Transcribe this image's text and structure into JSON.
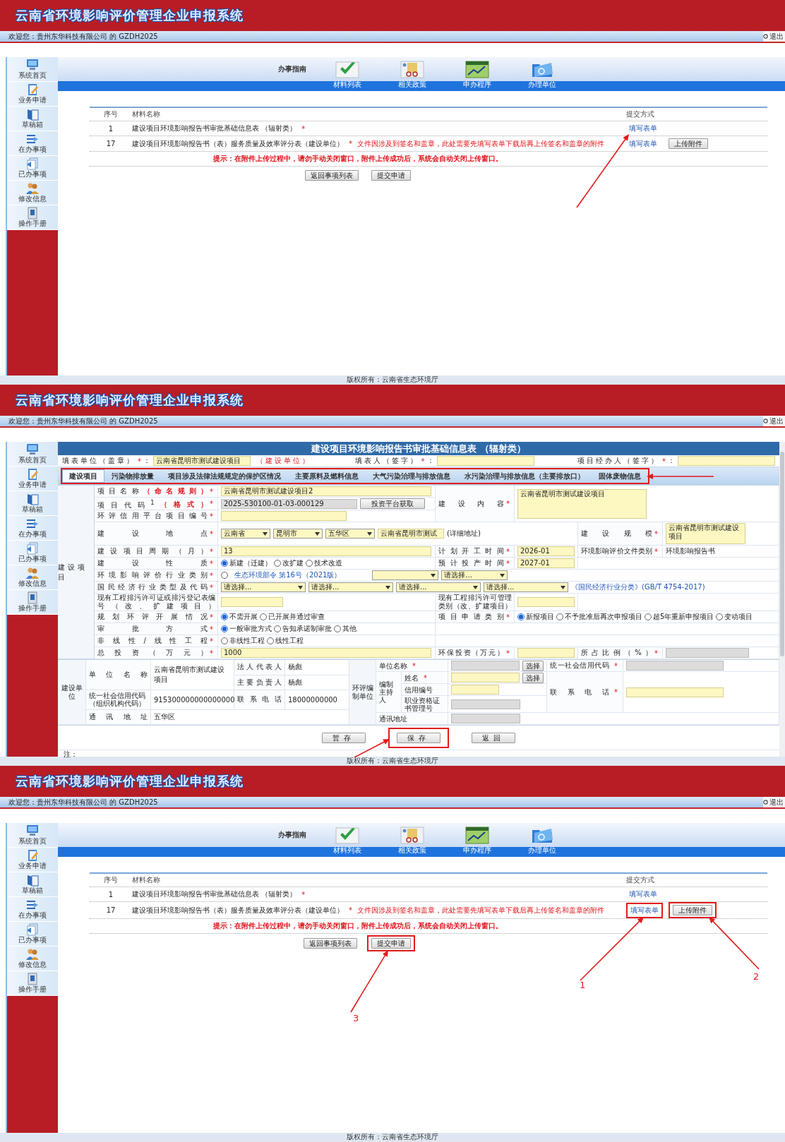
{
  "screens": [
    {
      "kind": "list",
      "title": "云南省环境影响评价管理企业申报系统",
      "welcome": "欢迎您：贵州东华科技有限公司 的 GZDH2025",
      "logout": "退出",
      "sidebar": [
        {
          "label": "系统首页"
        },
        {
          "label": "业务申请"
        },
        {
          "label": "草稿箱"
        },
        {
          "label": "在办事项"
        },
        {
          "label": "已办事项"
        },
        {
          "label": "修改信息"
        },
        {
          "label": "操作手册"
        }
      ],
      "guide": {
        "label": "办事指南",
        "items": [
          {
            "label": "材料列表"
          },
          {
            "label": "相关政策"
          },
          {
            "label": "申办程序"
          },
          {
            "label": "办理单位"
          }
        ]
      },
      "table": {
        "columns": [
          "序号",
          "材料名称",
          "提交方式"
        ],
        "rows": [
          {
            "no": "1",
            "name": "建设项目环境影响报告书审批基础信息表 （辐射类）",
            "required": true,
            "mark": "*",
            "actions": [
              {
                "kind": "link",
                "label": "填写表单",
                "highlighted": false,
                "pointer": true
              }
            ]
          },
          {
            "no": "17",
            "name": "建设项目环境影响报告书（表）服务质量及效率评分表（建设单位）",
            "required": true,
            "mark": "*",
            "note": "文件因涉及到签名和盖章，此处需要先填写表单下载后再上传签名和盖章的附件",
            "actions": [
              {
                "kind": "link",
                "label": "填写表单",
                "highlighted": false,
                "pointer": false
              },
              {
                "kind": "button",
                "label": "上传附件",
                "highlighted": false,
                "pointer": false
              }
            ]
          }
        ]
      },
      "hint": "提示：在附件上传过程中，请勿手动关闭窗口，附件上传成功后，系统会自动关闭上传窗口。",
      "buttons": [
        {
          "label": "返回事项列表",
          "highlighted": false,
          "pointer": false
        },
        {
          "label": "提交申请",
          "highlighted": false,
          "pointer": false
        }
      ],
      "footer": "版权所有：云南省生态环境厅"
    },
    {
      "kind": "form",
      "title": "云南省环境影响评价管理企业申报系统",
      "welcome": "欢迎您：贵州东华科技有限公司 的 GZDH2025",
      "logout": "退出",
      "sidebar": [
        {
          "label": "系统首页"
        },
        {
          "label": "业务申请"
        },
        {
          "label": "草稿箱"
        },
        {
          "label": "在办事项"
        },
        {
          "label": "已办事项"
        },
        {
          "label": "修改信息"
        },
        {
          "label": "操作手册"
        }
      ],
      "form": {
        "title": "建设项目环境影响报告书审批基础信息表 （辐射类）",
        "signers": [
          {
            "label": "填表单位（盖章）",
            "required": true,
            "mark": "*",
            "colon": "：",
            "value": "云南省昆明市测试建设项目",
            "suffix": "（建设单位）"
          },
          {
            "label": "填表人（签字）",
            "required": true,
            "mark": "*",
            "colon": "："
          },
          {
            "label": "项目经办人（签字）",
            "required": true,
            "mark": "*",
            "colon": "："
          }
        ],
        "tabs": [
          {
            "label": "建设项目",
            "selected": true
          },
          {
            "label": "污染物排放量",
            "selected": false
          },
          {
            "label": "项目涉及法律法规规定的保护区情况",
            "selected": false
          },
          {
            "label": "主要原料及燃料信息",
            "selected": false
          },
          {
            "label": "大气污染治理与排放信息",
            "selected": false
          },
          {
            "label": "水污染治理与排放信息（主要排放口）",
            "selected": false
          },
          {
            "label": "固体废物信息",
            "selected": false
          }
        ],
        "tabs_highlighted": true,
        "tabs_pointer": true,
        "project": {
          "section": "建设项目",
          "rows": [
            {
              "groups": [
                {
                  "label": "项目名称",
                  "rule": "（命名规则）",
                  "required": true,
                  "mark": "*",
                  "fields": [
                    {
                      "kind": "input",
                      "value": "云南省昆明市测试建设项目2"
                    }
                  ]
                },
                {
                  "label": "建设内容",
                  "required": true,
                  "mark": "*",
                  "fields": [
                    {
                      "kind": "textarea",
                      "value": "云南省昆明市测试建设项目"
                    }
                  ]
                }
              ]
            },
            {
              "groups": [
                {
                  "label": "项目代码$^{1}$",
                  "rule": "（格式）",
                  "required": true,
                  "mark": "*",
                  "fields": [
                    {
                      "kind": "input",
                      "value": "2025-530100-01-03-000129",
                      "readonly": true
                    },
                    {
                      "kind": "button",
                      "label": "投资平台获取"
                    }
                  ]
                }
              ]
            },
            {
              "groups": [
                {
                  "label": "环评信用平台项目编号",
                  "required": true,
                  "mark": "*",
                  "fields": [
                    {
                      "kind": "input"
                    }
                  ]
                }
              ]
            },
            {
              "groups": [
                {
                  "label": "建设地点",
                  "required": true,
                  "mark": "*",
                  "fields": [
                    {
                      "kind": "select",
                      "value": "云南省"
                    },
                    {
                      "kind": "select",
                      "value": "昆明市"
                    },
                    {
                      "kind": "select",
                      "value": "五华区"
                    },
                    {
                      "kind": "input",
                      "value": "云南省昆明市测试"
                    },
                    {
                      "kind": "text",
                      "text": "(详细地址)"
                    }
                  ]
                },
                {
                  "label": "建设规模",
                  "required": true,
                  "mark": "*",
                  "fields": [
                    {
                      "kind": "textarea",
                      "value": "云南省昆明市测试建设项目"
                    }
                  ]
                }
              ]
            },
            {
              "groups": [
                {
                  "label": "建设项目周期（月）",
                  "required": true,
                  "mark": "*",
                  "fields": [
                    {
                      "kind": "input",
                      "value": "13"
                    }
                  ]
                },
                {
                  "label": "计划开工时间",
                  "required": true,
                  "mark": "*",
                  "fields": [
                    {
                      "kind": "input",
                      "value": "2026-01"
                    }
                  ]
                },
                {
                  "label": "环境影响评价文件类别",
                  "required": true,
                  "mark": "*",
                  "fields": [
                    {
                      "kind": "text",
                      "text": "环境影响报告书"
                    }
                  ]
                }
              ]
            },
            {
              "groups": [
                {
                  "label": "建设性质",
                  "required": true,
                  "mark": "*",
                  "fields": [
                    {
                      "kind": "radio",
                      "options": [
                        {
                          "label": "新建（迁建）",
                          "selected": true
                        },
                        {
                          "label": "改扩建",
                          "selected": false
                        },
                        {
                          "label": "技术改造",
                          "selected": false
                        }
                      ]
                    }
                  ]
                },
                {
                  "label": "预计投产时间",
                  "required": true,
                  "mark": "*",
                  "fields": [
                    {
                      "kind": "input",
                      "value": "2027-01"
                    }
                  ]
                }
              ]
            },
            {
              "groups": [
                {
                  "label": "环境影响评价行业类别",
                  "required": true,
                  "mark": "*",
                  "fields": [
                    {
                      "kind": "radio",
                      "options": [
                        {
                          "selected": false
                        }
                      ]
                    },
                    {
                      "kind": "link",
                      "text": "生态环境部令 第16号（2021版）"
                    },
                    {
                      "kind": "select"
                    },
                    {
                      "kind": "select",
                      "value": "请选择..."
                    }
                  ]
                }
              ]
            },
            {
              "groups": [
                {
                  "label": "国民经济行业类型及代码",
                  "required": true,
                  "mark": "*",
                  "fields": [
                    {
                      "kind": "select",
                      "value": "请选择..."
                    },
                    {
                      "kind": "select",
                      "value": "请选择..."
                    },
                    {
                      "kind": "select",
                      "value": "请选择..."
                    },
                    {
                      "kind": "select",
                      "value": "请选择..."
                    },
                    {
                      "kind": "link",
                      "text": "《国民经济行业分类》(GB/T 4754-2017)"
                    }
                  ]
                }
              ]
            },
            {
              "groups": [
                {
                  "label": "现有工程排污许可证或排污登记表编号（改、扩建项目）",
                  "required": false,
                  "fields": [
                    {
                      "kind": "input"
                    }
                  ]
                },
                {
                  "label": "现有工程排污许可管理类别（改、扩建项目）",
                  "required": false,
                  "fields": [
                    {
                      "kind": "input"
                    }
                  ]
                }
              ]
            },
            {
              "groups": [
                {
                  "label": "规划环评开展情况",
                  "required": true,
                  "mark": "*",
                  "fields": [
                    {
                      "kind": "radio",
                      "options": [
                        {
                          "label": "不需开展",
                          "selected": true
                        },
                        {
                          "label": "已开展并通过审查",
                          "selected": false
                        }
                      ]
                    }
                  ]
                },
                {
                  "label": "项目申请类别",
                  "required": true,
                  "mark": "*",
                  "fields": [
                    {
                      "kind": "radio",
                      "options": [
                        {
                          "label": "新报项目",
                          "selected": true
                        },
                        {
                          "label": "不予批准后再次申报项目",
                          "selected": false
                        },
                        {
                          "label": "超5年重新申报项目",
                          "selected": false
                        },
                        {
                          "label": "变动项目",
                          "selected": false
                        }
                      ]
                    }
                  ]
                }
              ]
            },
            {
              "groups": [
                {
                  "label": "审批方式",
                  "required": true,
                  "mark": "*",
                  "fields": [
                    {
                      "kind": "radio",
                      "options": [
                        {
                          "label": "一般审批方式",
                          "selected": true
                        },
                        {
                          "label": "告知承诺制审批",
                          "selected": false
                        },
                        {
                          "label": "其他",
                          "selected": false
                        }
                      ]
                    }
                  ]
                }
              ]
            },
            {
              "groups": [
                {
                  "label": "非线性/线性工程",
                  "required": true,
                  "mark": "*",
                  "fields": [
                    {
                      "kind": "radio",
                      "options": [
                        {
                          "label": "非线性工程",
                          "selected": false
                        },
                        {
                          "label": "线性工程",
                          "selected": false
                        }
                      ]
                    }
                  ]
                }
              ]
            },
            {
              "groups": [
                {
                  "label": "总投资（万元）",
                  "required": true,
                  "mark": "*",
                  "fields": [
                    {
                      "kind": "input",
                      "value": "1000"
                    }
                  ]
                },
                {
                  "label": "环保投资（万元）",
                  "required": true,
                  "mark": "*",
                  "fields": [
                    {
                      "kind": "input"
                    }
                  ]
                },
                {
                  "label": "所占比例（%）",
                  "required": true,
                  "mark": "*",
                  "fields": [
                    {
                      "kind": "input",
                      "readonly": true
                    }
                  ]
                }
              ]
            }
          ]
        },
        "builder": {
          "label": "建设单位",
          "name": {
            "label": "单位名称",
            "value": "云南省昆明市测试建设项目"
          },
          "legal": {
            "label": "法人代表人",
            "value": "杨彪"
          },
          "head": {
            "label": "主要负责人",
            "value": "杨彪"
          },
          "credit": {
            "label": "统一社会信用代码（组织机构代码）",
            "value": "915300000000000000"
          },
          "phone": {
            "label": "联系电话",
            "value": "18000000000"
          },
          "address": {
            "label": "通讯地址",
            "value": "五华区"
          }
        },
        "preparer": {
          "label": "环评编制单位",
          "name": {
            "label": "单位名称",
            "required": true,
            "mark": "*",
            "readonly": true,
            "button": "选择"
          },
          "credit": {
            "label": "统一社会信用代码",
            "required": true,
            "mark": "*",
            "readonly": true
          },
          "host": "编制主持人",
          "host_name": {
            "label": "姓名",
            "required": true,
            "mark": "*",
            "button": "选择"
          },
          "host_credit": {
            "label": "信用编号"
          },
          "host_cert": {
            "label": "职业资格证书管理号",
            "readonly": true
          },
          "phone": {
            "label": "联系电话",
            "required": true,
            "mark": "*"
          },
          "address": {
            "label": "通讯地址",
            "readonly": true
          }
        },
        "buttons": [
          {
            "label": "暂存",
            "highlighted": false,
            "pointer": false
          },
          {
            "label": "保存",
            "highlighted": true,
            "pointer": true
          },
          {
            "label": "返回",
            "highlighted": false,
            "pointer": false
          }
        ],
        "note": "注："
      },
      "footer": "版权所有：云南省生态环境厅"
    },
    {
      "kind": "list",
      "title": "云南省环境影响评价管理企业申报系统",
      "welcome": "欢迎您：贵州东华科技有限公司 的 GZDH2025",
      "logout": "退出",
      "sidebar": [
        {
          "label": "系统首页"
        },
        {
          "label": "业务申请"
        },
        {
          "label": "草稿箱"
        },
        {
          "label": "在办事项"
        },
        {
          "label": "已办事项"
        },
        {
          "label": "修改信息"
        },
        {
          "label": "操作手册"
        }
      ],
      "guide": {
        "label": "办事指南",
        "items": [
          {
            "label": "材料列表"
          },
          {
            "label": "相关政策"
          },
          {
            "label": "申办程序"
          },
          {
            "label": "办理单位"
          }
        ]
      },
      "table": {
        "columns": [
          "序号",
          "材料名称",
          "提交方式"
        ],
        "rows": [
          {
            "no": "1",
            "name": "建设项目环境影响报告书审批基础信息表 （辐射类）",
            "required": true,
            "mark": "*",
            "actions": [
              {
                "kind": "link",
                "label": "填写表单",
                "highlighted": false,
                "pointer": false
              }
            ]
          },
          {
            "no": "17",
            "name": "建设项目环境影响报告书（表）服务质量及效率评分表（建设单位）",
            "required": true,
            "mark": "*",
            "note": "文件因涉及到签名和盖章，此处需要先填写表单下载后再上传签名和盖章的附件",
            "actions": [
              {
                "kind": "link",
                "label": "填写表单",
                "highlighted": true,
                "pointer": true,
                "callout": "1"
              },
              {
                "kind": "button",
                "label": "上传附件",
                "highlighted": true,
                "pointer": true,
                "callout": "2"
              }
            ]
          }
        ]
      },
      "hint": "提示：在附件上传过程中，请勿手动关闭窗口，附件上传成功后，系统会自动关闭上传窗口。",
      "buttons": [
        {
          "label": "返回事项列表",
          "highlighted": false,
          "pointer": false
        },
        {
          "label": "提交申请",
          "highlighted": true,
          "pointer": true,
          "callout": "3"
        }
      ],
      "footer": "版权所有：云南省生态环境厅"
    }
  ]
}
